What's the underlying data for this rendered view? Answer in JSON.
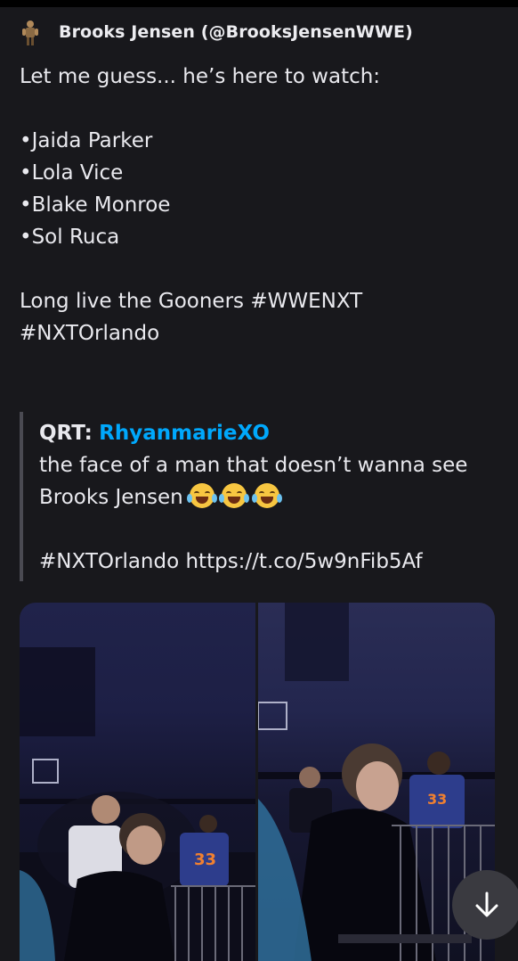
{
  "post": {
    "author": "Brooks Jensen (@BrooksJensenWWE)",
    "body": "Let me guess... he’s here to watch:\n\n•Jaida Parker\n•Lola Vice\n•Blake Monroe\n•Sol Ruca\n\nLong live the Gooners #WWENXT\n#NXTOrlando"
  },
  "quote": {
    "label": "QRT:",
    "user": "RhyanmarieXO",
    "text_line1": "the face of a man that doesn’t wanna see",
    "text_line2": "Brooks Jensen",
    "emoji": "joy-emoji x3",
    "text_tail": "\n#NXTOrlando https://t.co/5w9nFib5Af"
  },
  "media": {
    "left_photo_caption": "",
    "right_photo_caption": "",
    "jersey_number_left": "33",
    "jersey_number_right": "33"
  },
  "ui": {
    "scroll_icon": "arrow-down-icon",
    "link_color": "#00a8fc",
    "background_color": "#18181c"
  }
}
